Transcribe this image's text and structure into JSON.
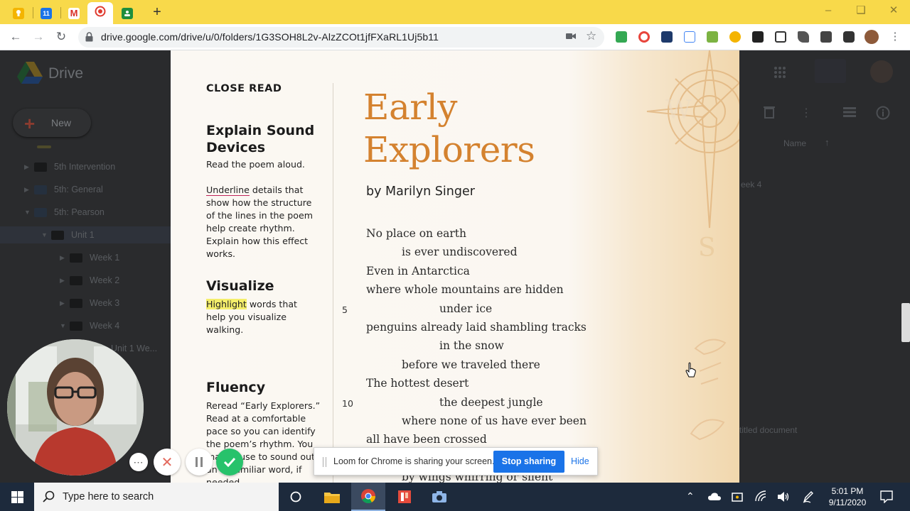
{
  "browser": {
    "tabs": [
      {
        "icon": "keep-icon",
        "color": "#f4b400"
      },
      {
        "icon": "calendar-icon",
        "color": "#1a73e8",
        "label": "11"
      },
      {
        "icon": "gmail-icon",
        "color": "#d93025",
        "label": "M"
      },
      {
        "icon": "loom-record-icon",
        "color": "#e03b2f",
        "active": true
      },
      {
        "icon": "classroom-icon",
        "color": "#1e8e3e"
      }
    ],
    "url": "drive.google.com/drive/u/0/folders/1G3SOH8L2v-AlzZCOt1jfFXaRL1Uj5b11"
  },
  "drive": {
    "title": "Drive",
    "new_label": "New",
    "tree": [
      {
        "label": "5th Intervention",
        "level": 1
      },
      {
        "label": "5th: General",
        "level": 1
      },
      {
        "label": "5th: Pearson",
        "level": 1
      },
      {
        "label": "Unit 1",
        "level": 2
      },
      {
        "label": "Week 1",
        "level": 3
      },
      {
        "label": "Week 2",
        "level": 3
      },
      {
        "label": "Week 3",
        "level": 3
      },
      {
        "label": "Week 4",
        "level": 3
      },
      {
        "label": "Unit 1 We...",
        "level": 4
      }
    ],
    "column_header": "Name",
    "partial_week": "eek 4",
    "partial_doc": "titled document"
  },
  "page": {
    "close_read": "CLOSE READ",
    "sections": {
      "explain": {
        "heading_1": "Explain Sound",
        "heading_2": "Devices",
        "instruction": "Read the poem aloud.",
        "underline_word": "Underline",
        "lines": [
          "details that",
          "show how the structure",
          "of the lines in the poem",
          "help create rhythm.",
          "Explain how this effect",
          "works."
        ]
      },
      "visualize": {
        "heading": "Visualize",
        "highlight_word": "Highlight",
        "lines": [
          "words that",
          "help you visualize",
          "walking."
        ]
      },
      "fluency": {
        "heading": "Fluency",
        "lines": [
          "Reread “Early Explorers.”",
          "Read at a comfortable",
          "pace so you can identify",
          "the poem’s rhythm. You",
          "may pause to sound out",
          "an unfamiliar word, if",
          "needed."
        ]
      }
    },
    "title_line1": "Early",
    "title_line2": "Explorers",
    "author": "by Marilyn Singer",
    "poem": [
      {
        "text": "No place on earth",
        "indent": 0
      },
      {
        "text": "is ever undiscovered",
        "indent": 1
      },
      {
        "text": "Even in Antarctica",
        "indent": 0
      },
      {
        "text": "where whole mountains are hidden",
        "indent": 0
      },
      {
        "text": "under ice",
        "indent": 2,
        "number": "5"
      },
      {
        "text": "penguins already laid shambling tracks",
        "indent": 0
      },
      {
        "text": "in the snow",
        "indent": 2
      },
      {
        "text": "before we traveled there",
        "indent": 1
      },
      {
        "text": "The hottest desert",
        "indent": 0
      },
      {
        "text": "the deepest jungle",
        "indent": 2,
        "number": "10"
      },
      {
        "text": "where none of us have ever been",
        "indent": 1
      },
      {
        "text": "all have been crossed",
        "indent": 0
      },
      {
        "text": "",
        "indent": 0
      },
      {
        "text": "by wings whirring or silent",
        "indent": 1
      }
    ]
  },
  "loom": {
    "message": "Loom for Chrome is sharing your screen.",
    "stop_label": "Stop sharing",
    "hide_label": "Hide",
    "controls": [
      "more-icon",
      "cancel-icon",
      "pause-icon",
      "finish-check-icon"
    ]
  },
  "taskbar": {
    "search_placeholder": "Type here to search",
    "apps": [
      "task-view-icon",
      "file-explorer-icon",
      "chrome-icon",
      "flashcard-app-icon",
      "camera-icon"
    ],
    "time": "5:01 PM",
    "date": "9/11/2020"
  },
  "colors": {
    "chrome_frame": "#f8d94a",
    "title_orange": "#d4822f",
    "loom_blue": "#1a73e8",
    "loom_green": "#27c26b"
  }
}
